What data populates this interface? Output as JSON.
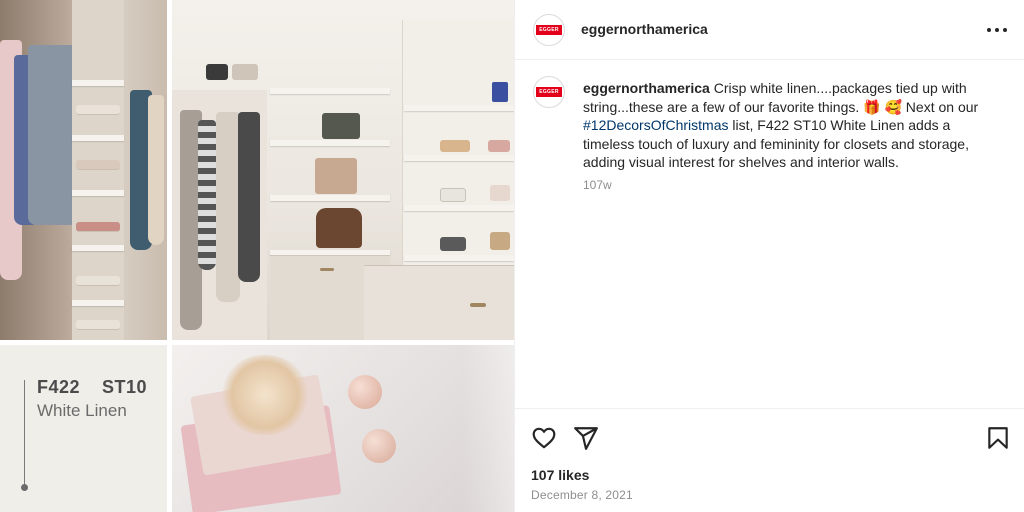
{
  "post": {
    "username": "eggernorthamerica",
    "avatar_logo_text": "EGGER",
    "more_icon": "more-horizontal-icon",
    "caption": {
      "username": "eggernorthamerica",
      "text_part1": " Crisp white linen....packages tied up with string...these are a few of our favorite things. ",
      "emoji_1": "🎁",
      "emoji_2": "🥰",
      "text_part2": " Next on our ",
      "hashtag": "#12DecorsOfChristmas",
      "text_part3": " list, F422 ST10 White Linen adds a timeless touch of luxury and femininity for closets and storage, adding visual interest for shelves and interior walls."
    },
    "time_ago": "107w",
    "likes": "107 likes",
    "date": "December 8, 2021",
    "icons": {
      "like": "heart-icon",
      "share": "paper-plane-icon",
      "save": "bookmark-icon"
    }
  },
  "media": {
    "swatch_code": "F422    ST10",
    "swatch_name": "White Linen"
  }
}
